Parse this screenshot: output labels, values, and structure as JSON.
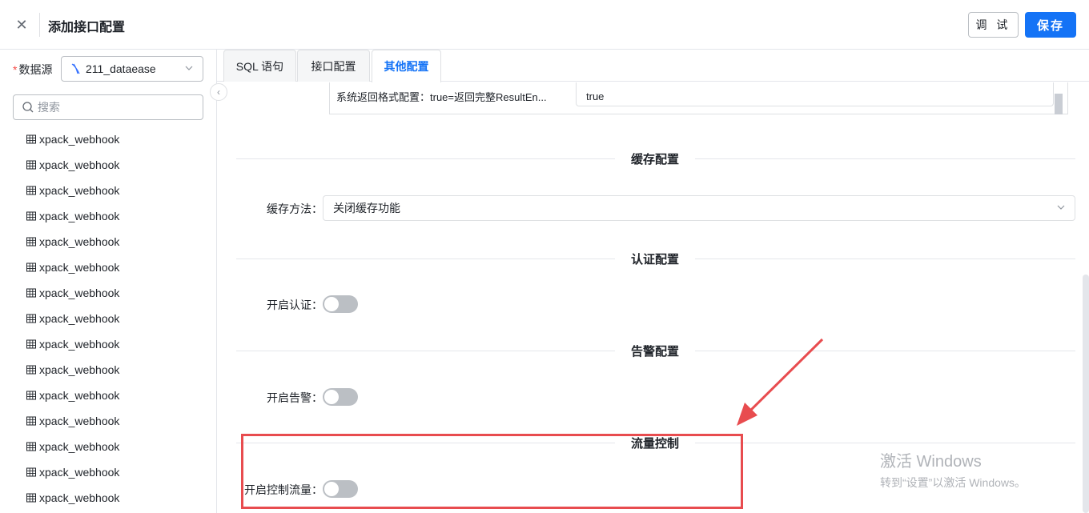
{
  "header": {
    "title": "添加接口配置",
    "debug_label": "调 试",
    "save_label": "保存"
  },
  "left": {
    "datasource_label": "数据源",
    "datasource_value": "211_dataease",
    "search_placeholder": "搜索",
    "tables": [
      "xpack_webhook",
      "xpack_webhook",
      "xpack_webhook",
      "xpack_webhook",
      "xpack_webhook",
      "xpack_webhook",
      "xpack_webhook",
      "xpack_webhook",
      "xpack_webhook",
      "xpack_webhook",
      "xpack_webhook",
      "xpack_webhook",
      "xpack_webhook",
      "xpack_webhook",
      "xpack_webhook"
    ]
  },
  "tabs": [
    "SQL 语句",
    "接口配置",
    "其他配置"
  ],
  "content": {
    "return_config_label": "系统返回格式配置：true=返回完整ResultEn...",
    "return_config_value": "true",
    "cache_section": "缓存配置",
    "cache_method_label": "缓存方法：",
    "cache_method_value": "关闭缓存功能",
    "auth_section": "认证配置",
    "auth_label": "开启认证：",
    "alert_section": "告警配置",
    "alert_label": "开启告警：",
    "flow_section": "流量控制",
    "flow_label": "开启控制流量："
  },
  "watermark": {
    "line1": "激活 Windows",
    "line2": "转到“设置”以激活 Windows。"
  },
  "colors": {
    "primary": "#1473f6",
    "annotation_red": "#e84c4f"
  }
}
